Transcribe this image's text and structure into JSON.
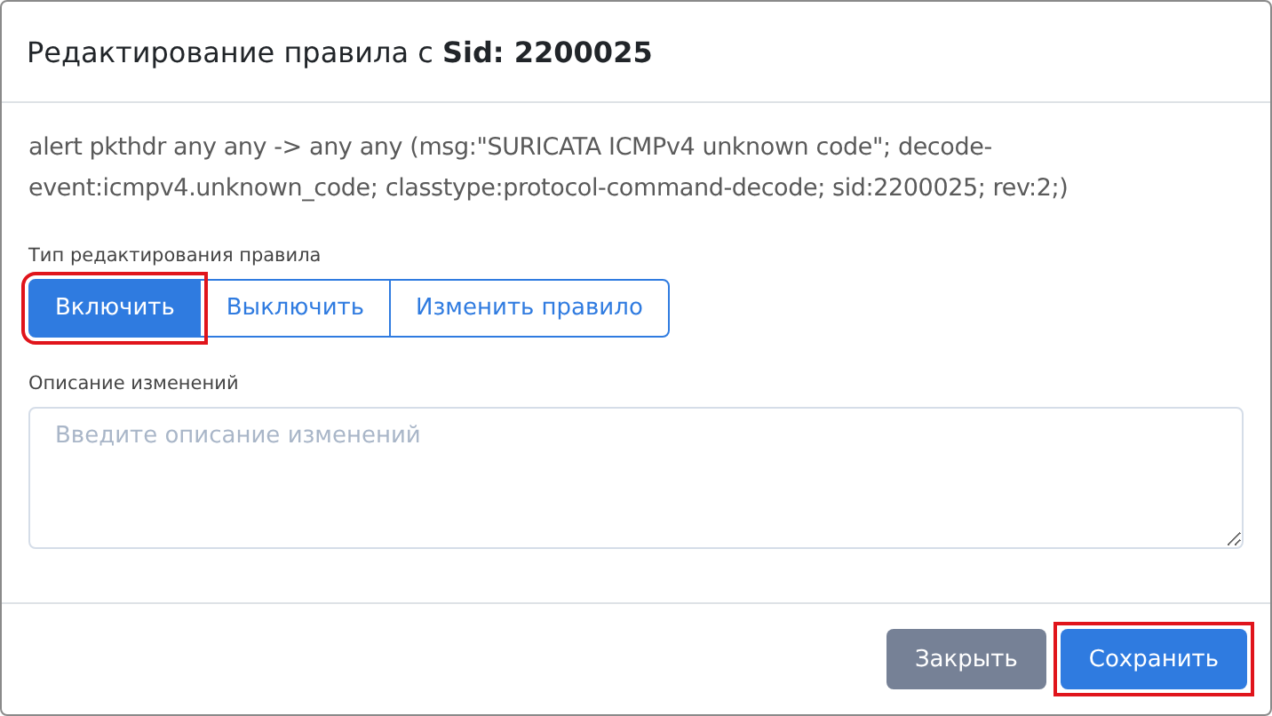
{
  "dialog": {
    "title": "Редактирование правила с **Sid: 2200025**",
    "rule_text": "alert pkthdr any any -> any any (msg:\"SURICATA ICMPv4 unknown code\"; decode-event:icmpv4.unknown_code; classtype:protocol-command-decode; sid:2200025; rev:2;)",
    "edit_type": {
      "label": "Тип редактирования правила",
      "options": [
        {
          "label": "Включить",
          "selected": true,
          "highlighted": true
        },
        {
          "label": "Выключить",
          "selected": false,
          "highlighted": false
        },
        {
          "label": "Изменить правило",
          "selected": false,
          "highlighted": false
        }
      ]
    },
    "description": {
      "label": "Описание изменений",
      "placeholder": "Введите описание изменений"
    },
    "buttons": [
      {
        "label": "Закрыть",
        "kind": "secondary",
        "highlighted": false
      },
      {
        "label": "Сохранить",
        "kind": "primary",
        "highlighted": true
      }
    ]
  }
}
